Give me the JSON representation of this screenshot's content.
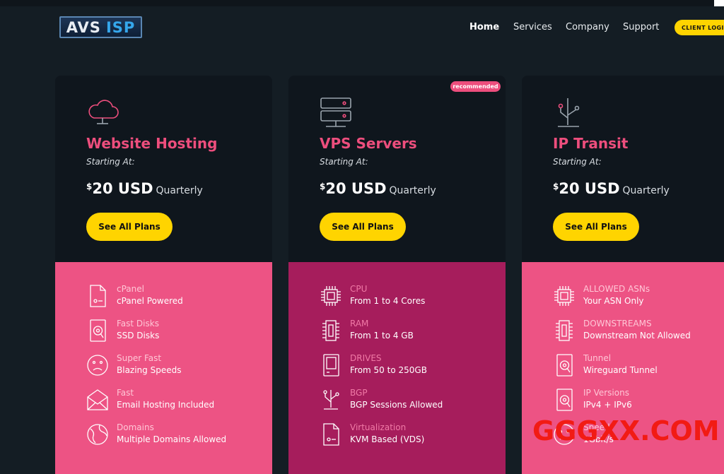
{
  "brand": {
    "part1": "AVS",
    "part2": "ISP"
  },
  "nav": {
    "items": [
      "Home",
      "Services",
      "Company",
      "Support"
    ],
    "active": "Home",
    "login_label": "CLIENT LOGIN"
  },
  "colors": {
    "background": "#141d24",
    "accent_pink": "#ed4e7d",
    "accent_yellow": "#ffd400",
    "magenta_panel": "#a61d5c"
  },
  "cards": [
    {
      "icon": "cloud-icon",
      "title": "Website Hosting",
      "starting": "Starting At:",
      "currency": "$",
      "amount": "20 USD",
      "period": "Quarterly",
      "button": "See All Plans",
      "badge": "",
      "features": [
        {
          "icon": "document-icon",
          "label": "cPanel",
          "value": "cPanel Powered"
        },
        {
          "icon": "disk-icon",
          "label": "Fast Disks",
          "value": "SSD Disks"
        },
        {
          "icon": "speed-face-icon",
          "label": "Super Fast",
          "value": "Blazing Speeds"
        },
        {
          "icon": "envelope-icon",
          "label": "Fast",
          "value": "Email Hosting Included"
        },
        {
          "icon": "globe-icon",
          "label": "Domains",
          "value": "Multiple Domains Allowed"
        }
      ]
    },
    {
      "icon": "server-icon",
      "title": "VPS Servers",
      "starting": "Starting At:",
      "currency": "$",
      "amount": "20 USD",
      "period": "Quarterly",
      "button": "See All Plans",
      "badge": "recommended",
      "features": [
        {
          "icon": "cpu-icon",
          "label": "CPU",
          "value": "From 1 to 4 Cores"
        },
        {
          "icon": "ram-icon",
          "label": "RAM",
          "value": "From 1 to 4 GB"
        },
        {
          "icon": "drive-icon",
          "label": "DRIVES",
          "value": "From 50 to 250GB"
        },
        {
          "icon": "network-icon",
          "label": "BGP",
          "value": "BGP Sessions Allowed"
        },
        {
          "icon": "document-icon",
          "label": "Virtualization",
          "value": "KVM Based (VDS)"
        }
      ]
    },
    {
      "icon": "network-icon",
      "title": "IP Transit",
      "starting": "Starting At:",
      "currency": "$",
      "amount": "20 USD",
      "period": "Quarterly",
      "button": "See All Plans",
      "badge": "",
      "features": [
        {
          "icon": "cpu-icon",
          "label": "ALLOWED ASNs",
          "value": "Your ASN Only"
        },
        {
          "icon": "ram-icon",
          "label": "DOWNSTREAMS",
          "value": "Downstream Not Allowed"
        },
        {
          "icon": "disk-icon",
          "label": "Tunnel",
          "value": "Wireguard Tunnel"
        },
        {
          "icon": "disk-icon",
          "label": "IP Versions",
          "value": "IPv4 + IPv6"
        },
        {
          "icon": "speed-face-icon",
          "label": "Speed",
          "value": "1Gbit/s"
        }
      ]
    }
  ],
  "watermark": "GGGXX.COM"
}
